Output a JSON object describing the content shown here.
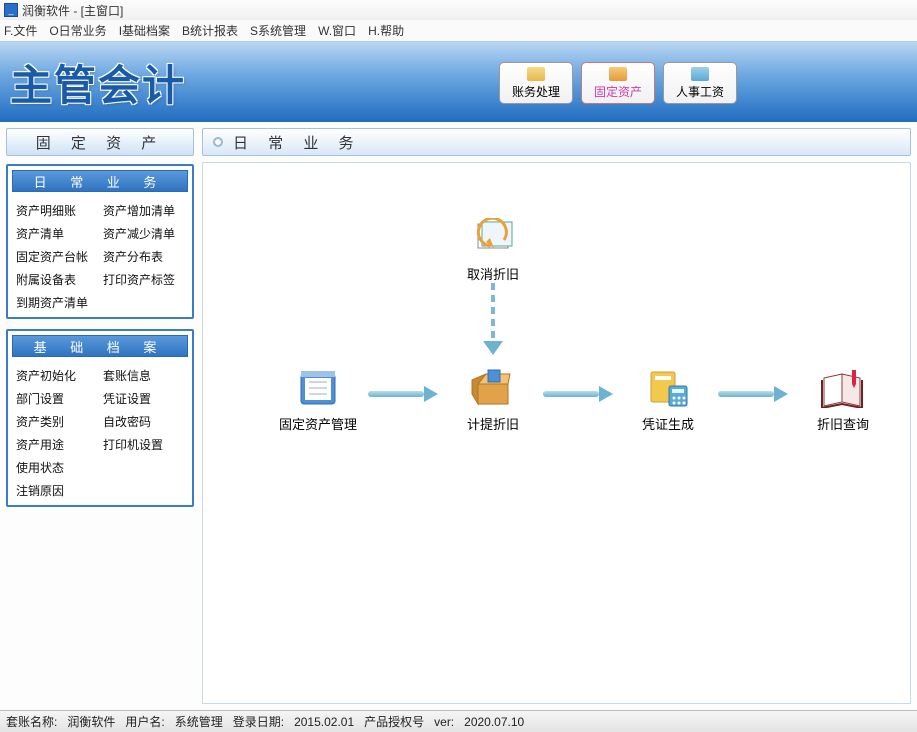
{
  "window": {
    "title": "润衡软件 - [主窗口]"
  },
  "menu": {
    "items": [
      "F.文件",
      "O日常业务",
      "I基础档案",
      "B统计报表",
      "S系统管理",
      "W.窗口",
      "H.帮助"
    ]
  },
  "header": {
    "title": "主管会计",
    "buttons": [
      {
        "label": "账务处理",
        "active": false
      },
      {
        "label": "固定资产",
        "active": true
      },
      {
        "label": "人事工资",
        "active": false
      }
    ]
  },
  "sidebar": {
    "module_title": "固 定 资 产",
    "sections": [
      {
        "title": "日 常 业 务",
        "links": [
          "资产明细账",
          "资产增加清单",
          "资产清单",
          "资产减少清单",
          "固定资产台帐",
          "资产分布表",
          "附属设备表",
          "打印资产标签",
          "到期资产清单"
        ]
      },
      {
        "title": "基 础 档 案",
        "links": [
          "资产初始化",
          "套账信息",
          "部门设置",
          "凭证设置",
          "资产类别",
          "自改密码",
          "资产用途",
          "打印机设置",
          "使用状态",
          "注销原因"
        ]
      }
    ]
  },
  "content": {
    "title": "日 常 业 务",
    "nodes": {
      "cancel_depr": "取消折旧",
      "asset_mgmt": "固定资产管理",
      "accrue_depr": "计提折旧",
      "voucher_gen": "凭证生成",
      "depr_query": "折旧查询"
    }
  },
  "statusbar": {
    "account_label": "套账名称:",
    "account_value": "润衡软件",
    "user_label": "用户名:",
    "user_value": "系统管理",
    "login_label": "登录日期:",
    "login_value": "2015.02.01",
    "lic_label": "产品授权号",
    "ver_label": "ver:",
    "ver_value": "2020.07.10"
  }
}
